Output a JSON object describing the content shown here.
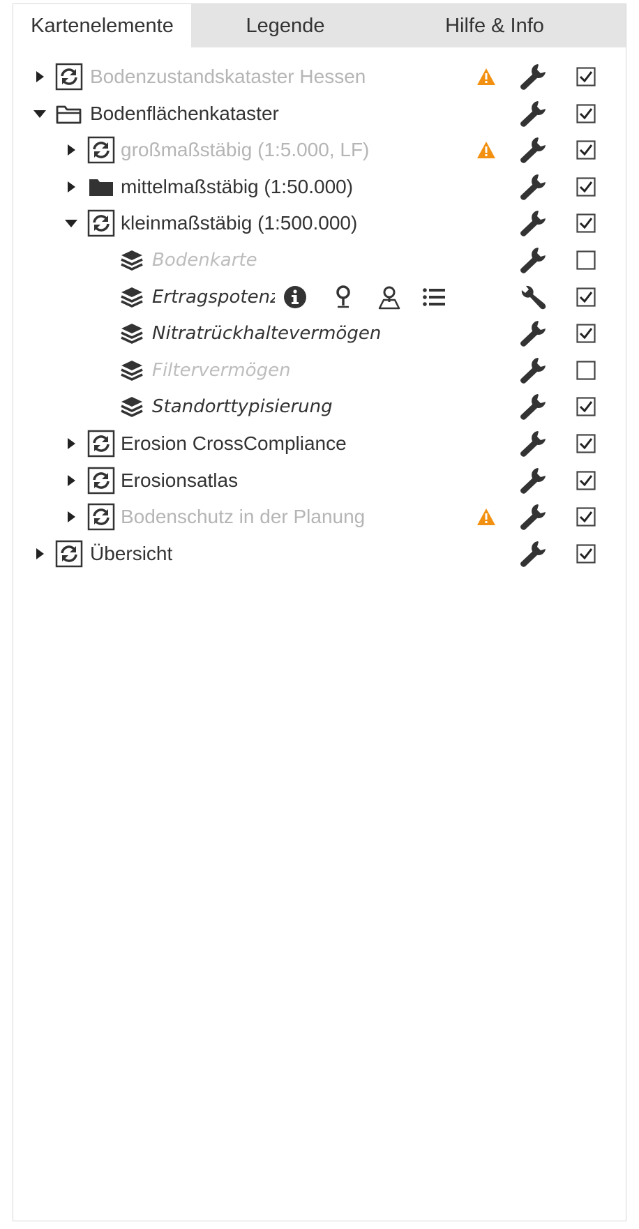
{
  "tabs": [
    {
      "label": "Kartenelemente",
      "active": true
    },
    {
      "label": "Legende",
      "active": false
    },
    {
      "label": "Hilfe & Info",
      "active": false
    }
  ],
  "tree": [
    {
      "label": "Bodenzustandskataster Hessen",
      "depth": 0,
      "caret": "right",
      "icon": "refresh-icon",
      "dimmed": true,
      "italic": false,
      "warning": true,
      "checked": true
    },
    {
      "label": "Bodenflächenkataster",
      "depth": 0,
      "caret": "down",
      "icon": "folder-open-icon",
      "dimmed": false,
      "italic": false,
      "warning": false,
      "checked": true
    },
    {
      "label": "großmaßstäbig (1:5.000, LF)",
      "depth": 1,
      "caret": "right",
      "icon": "refresh-icon",
      "dimmed": true,
      "italic": false,
      "warning": true,
      "checked": true
    },
    {
      "label": "mittelmaßstäbig (1:50.000)",
      "depth": 1,
      "caret": "right",
      "icon": "folder-icon",
      "dimmed": false,
      "italic": false,
      "warning": false,
      "checked": true
    },
    {
      "label": "kleinmaßstäbig (1:500.000)",
      "depth": 1,
      "caret": "down",
      "icon": "refresh-icon",
      "dimmed": false,
      "italic": false,
      "warning": false,
      "checked": true
    },
    {
      "label": "Bodenkarte",
      "depth": 2,
      "caret": "none",
      "icon": "layers-icon",
      "dimmed": true,
      "italic": true,
      "warning": false,
      "checked": false
    },
    {
      "label": "Ertragspotenzial",
      "depth": 2,
      "caret": "none",
      "icon": "layers-icon",
      "dimmed": false,
      "italic": true,
      "warning": false,
      "checked": true,
      "hover_actions": true
    },
    {
      "label": "Nitratrückhaltevermögen",
      "depth": 2,
      "caret": "none",
      "icon": "layers-icon",
      "dimmed": false,
      "italic": true,
      "warning": false,
      "checked": true
    },
    {
      "label": "Filtervermögen",
      "depth": 2,
      "caret": "none",
      "icon": "layers-icon",
      "dimmed": true,
      "italic": true,
      "warning": false,
      "checked": false
    },
    {
      "label": "Standorttypisierung",
      "depth": 2,
      "caret": "none",
      "icon": "layers-icon",
      "dimmed": false,
      "italic": true,
      "warning": false,
      "checked": true
    },
    {
      "label": "Erosion CrossCompliance",
      "depth": 1,
      "caret": "right",
      "icon": "refresh-icon",
      "dimmed": false,
      "italic": false,
      "warning": false,
      "checked": true
    },
    {
      "label": "Erosionsatlas",
      "depth": 1,
      "caret": "right",
      "icon": "refresh-icon",
      "dimmed": false,
      "italic": false,
      "warning": false,
      "checked": true
    },
    {
      "label": "Bodenschutz in der Planung",
      "depth": 1,
      "caret": "right",
      "icon": "refresh-icon",
      "dimmed": true,
      "italic": false,
      "warning": true,
      "checked": true
    },
    {
      "label": "Übersicht",
      "depth": 0,
      "caret": "right",
      "icon": "refresh-icon",
      "dimmed": false,
      "italic": false,
      "warning": false,
      "checked": true
    }
  ],
  "hover_actions": [
    "info-icon",
    "map-pin-icon",
    "map-zoom-icon",
    "list-icon"
  ],
  "colors": {
    "tab_bar": "#e4e4e4",
    "warning": "#f29111",
    "dimmed_text": "#b5b5b5",
    "text": "#333333",
    "icon": "#333333"
  }
}
